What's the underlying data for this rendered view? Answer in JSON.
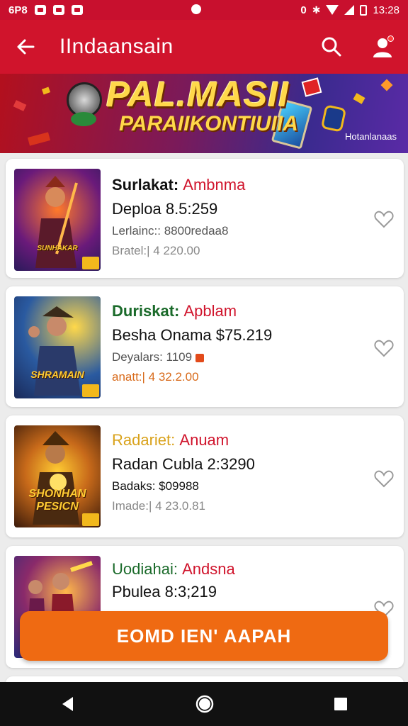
{
  "status_bar": {
    "left_text": "6P8",
    "time": "13:28",
    "right_label": "0"
  },
  "app_bar": {
    "title": "IIndaansain"
  },
  "banner": {
    "title": "PAL.MASII",
    "subtitle": "PARAIIKONTIUIIA",
    "tag": "Hotanlanaas"
  },
  "items": [
    {
      "label": "Surlakat:",
      "value": "Ambnma",
      "line2": "Deploa 8.5:259",
      "line3": "Lerlainc:: 8800redaa8",
      "line4": "Bratel:| 4 220.00",
      "thumb_caption": "SUNHAKAR"
    },
    {
      "label": "Duriskat:",
      "value": "Apblam",
      "line2": "Besha Onama $75.219",
      "line3": "Deyalars: 1109",
      "line4": "anatt:| 4 32.2.00",
      "thumb_caption": "SHRAMAIN"
    },
    {
      "label": "Radariet:",
      "value": "Anuam",
      "line2": "Radan Cubla 2:3290",
      "line3": "Badaks: $09988",
      "line4": "Imade:| 4 23.0.81",
      "thumb_caption": "SHONHAN PESICN"
    },
    {
      "label": "Uodiahai:",
      "value": "Andsna",
      "line2": "Pbulea 8:3;219",
      "line3": "",
      "line4": "",
      "thumb_caption": ""
    }
  ],
  "cta": {
    "label": "EOMD IEN' AAPAH"
  },
  "colors": {
    "primary": "#d0142c",
    "accent": "#ef6a12",
    "value_red": "#d0142c",
    "value_green": "#1a7a2a",
    "value_gold": "#d9a21b"
  }
}
